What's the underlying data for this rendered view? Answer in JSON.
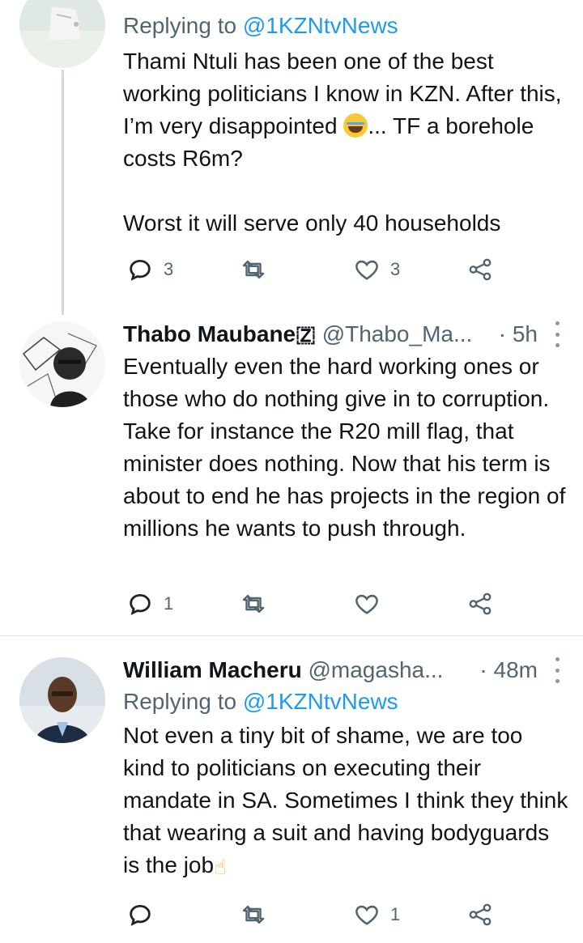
{
  "tweets": [
    {
      "replying_label": "Replying to",
      "replying_to": "@1KZNtvNews",
      "body_lines_1": "Thami Ntuli has been one of the best working politicians I know in KZN. After this, I’m very disappointed",
      "body_lines_2": "... TF a borehole costs R6m?",
      "body_lines_3": "Worst it will serve only 40 households",
      "emoji": "crying-face-emoji",
      "replies": "3",
      "retweets": "",
      "likes": "3"
    },
    {
      "display_name": "Thabo Maubane🇿",
      "handle": "@Thabo_Ma...",
      "time": "· 5h",
      "body": "Eventually even the hard working ones or those who do nothing give in to corruption. Take for instance the R20 mill flag, that minister does nothing. Now that his term is about to end he has projects in the region of millions he wants to push through.",
      "replies": "1",
      "retweets": "",
      "likes": ""
    },
    {
      "display_name": "William Macheru",
      "handle": "@magasha...",
      "time": "· 48m",
      "replying_label": "Replying to",
      "replying_to": "@1KZNtvNews",
      "body": "Not even a tiny bit of shame, we are too kind to politicians on executing their mandate in SA. Sometimes I think they think that wearing a suit and having bodyguards is the job",
      "emoji": "crossed-fingers-emoji",
      "replies": "",
      "retweets": "",
      "likes": "1"
    }
  ],
  "colors": {
    "text": "#0f1419",
    "secondary": "#536471",
    "link": "#1d9bf0",
    "thread_line": "#cfd9de",
    "divider": "#dfe3e6"
  }
}
